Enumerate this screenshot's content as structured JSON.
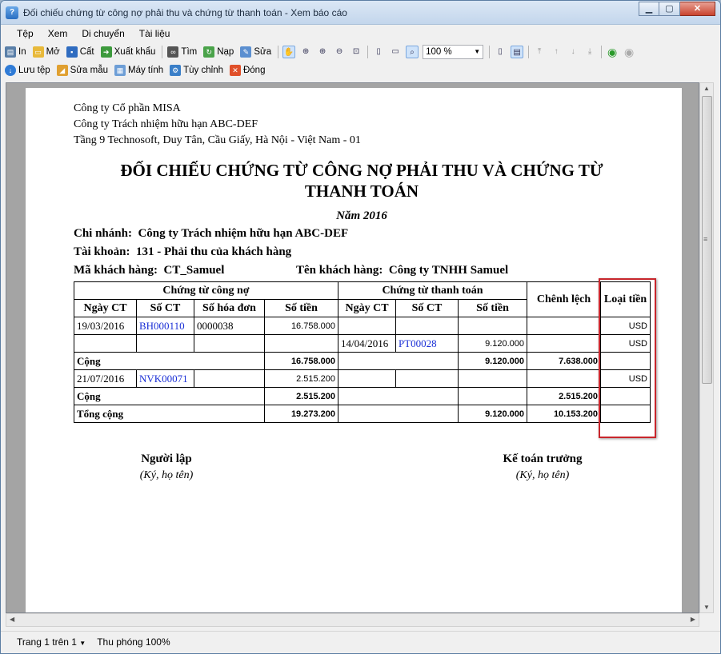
{
  "window": {
    "title": "Đối chiếu chứng từ công nợ phải thu và chứng từ thanh toán - Xem báo cáo"
  },
  "menu": [
    "Tệp",
    "Xem",
    "Di chuyển",
    "Tài liệu"
  ],
  "toolbar1": {
    "print": "In",
    "open": "Mở",
    "save": "Cất",
    "export": "Xuất khẩu",
    "find": "Tìm",
    "load": "Nạp",
    "edit": "Sửa",
    "zoom": "100 %"
  },
  "toolbar2": {
    "save_file": "Lưu tệp",
    "edit_template": "Sửa mẫu",
    "calculator": "Máy tính",
    "customize": "Tùy chỉnh",
    "close": "Đóng"
  },
  "report": {
    "company1": "Công ty Cổ phần MISA",
    "company2": "Công ty Trách nhiệm hữu hạn ABC-DEF",
    "address": "Tầng 9 Technosoft, Duy Tân, Cầu Giấy, Hà Nội - Việt Nam - 01",
    "title_line1": "ĐỐI CHIẾU CHỨNG TỪ CÔNG NỢ PHẢI THU VÀ CHỨNG TỪ",
    "title_line2": "THANH TOÁN",
    "year": "Năm 2016",
    "branch_label": "Chi nhánh:",
    "branch_value": "Công ty Trách nhiệm hữu hạn ABC-DEF",
    "account_label": "Tài khoản:",
    "account_value": "131 - Phải thu của khách hàng",
    "customer_code_label": "Mã khách hàng:",
    "customer_code_value": "CT_Samuel",
    "customer_name_label": "Tên khách hàng:",
    "customer_name_value": "Công ty TNHH Samuel",
    "table": {
      "group_debt": "Chứng từ công nợ",
      "group_payment": "Chứng từ thanh toán",
      "col_diff": "Chênh lệch",
      "col_currency": "Loại tiền",
      "col_date": "Ngày CT",
      "col_docno": "Số CT",
      "col_invoice": "Số hóa đơn",
      "col_amount": "Số tiền",
      "col_pay_date": "Ngày CT",
      "col_pay_docno": "Số CT",
      "col_pay_amount": "Số tiền",
      "rows": [
        {
          "date": "19/03/2016",
          "docno": "BH000110",
          "invoice": "0000038",
          "amount": "16.758.000",
          "pdate": "",
          "pdoc": "",
          "pamount": "",
          "diff": "",
          "cur": "USD"
        },
        {
          "date": "",
          "docno": "",
          "invoice": "",
          "amount": "",
          "pdate": "14/04/2016",
          "pdoc": "PT00028",
          "pamount": "9.120.000",
          "diff": "",
          "cur": "USD"
        },
        {
          "label": "Cộng",
          "amount": "16.758.000",
          "pamount": "9.120.000",
          "diff": "7.638.000"
        },
        {
          "date": "21/07/2016",
          "docno": "NVK00071",
          "invoice": "",
          "amount": "2.515.200",
          "pdate": "",
          "pdoc": "",
          "pamount": "",
          "diff": "",
          "cur": "USD"
        },
        {
          "label": "Cộng",
          "amount": "2.515.200",
          "pamount": "",
          "diff": "2.515.200"
        },
        {
          "label": "Tổng cộng",
          "amount": "19.273.200",
          "pamount": "9.120.000",
          "diff": "10.153.200"
        }
      ]
    },
    "sign_left_role": "Người lập",
    "sign_left_note": "(Ký, họ tên)",
    "sign_right_role": "Kế toán trưởng",
    "sign_right_note": "(Ký, họ tên)"
  },
  "status": {
    "page": "Trang 1 trên 1",
    "zoom": "Thu phóng 100%"
  }
}
